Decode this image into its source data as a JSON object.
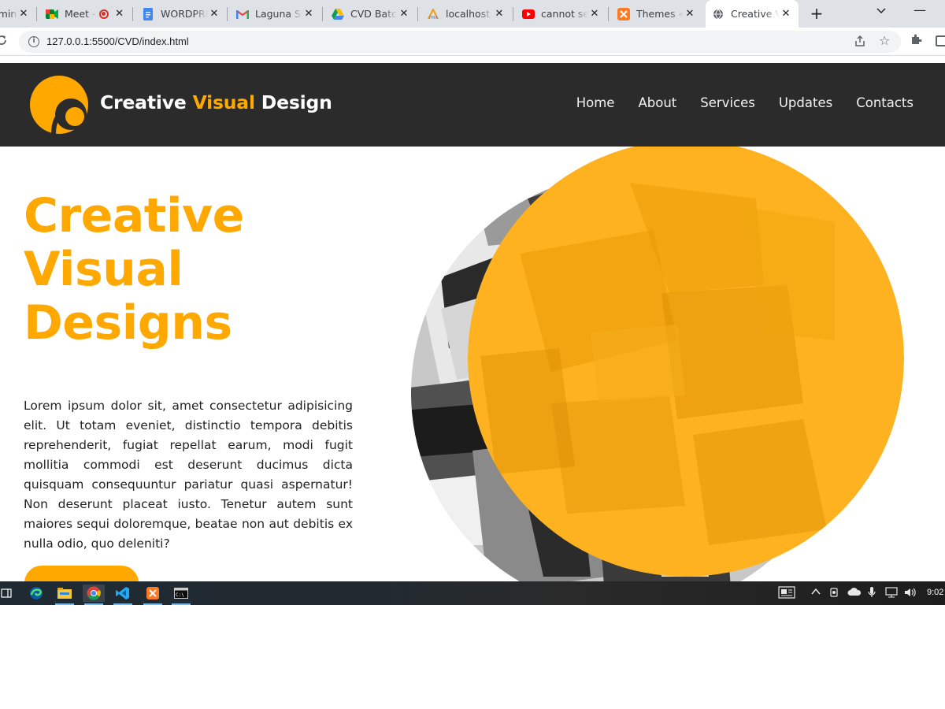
{
  "browser": {
    "tabs": [
      {
        "title": "amin",
        "icon": "yellow-square-icon",
        "active": false
      },
      {
        "title": "Meet - ",
        "icon": "google-meet-icon",
        "active": false,
        "recording": true
      },
      {
        "title": "WORDPRE",
        "icon": "google-docs-icon",
        "active": false
      },
      {
        "title": "Laguna Sta",
        "icon": "gmail-icon",
        "active": false
      },
      {
        "title": "CVD Batch",
        "icon": "google-drive-icon",
        "active": false
      },
      {
        "title": "localhost /",
        "icon": "phpmyadmin-icon",
        "active": false
      },
      {
        "title": "cannot sele",
        "icon": "youtube-icon",
        "active": false
      },
      {
        "title": "Themes « (",
        "icon": "xampp-icon",
        "active": false
      },
      {
        "title": "Creative V",
        "icon": "globe-icon",
        "active": true
      }
    ],
    "new_tab": "+",
    "url": "127.0.0.1:5500/CVD/index.html"
  },
  "site": {
    "brand": {
      "part1": "Creative ",
      "part2": "Visual",
      "part3": " Design"
    },
    "nav": [
      "Home",
      "About",
      "Services",
      "Updates",
      "Contacts"
    ],
    "hero": {
      "title_lines": [
        "Creative",
        "Visual",
        "Designs"
      ],
      "paragraph": "Lorem ipsum dolor sit, amet consectetur adipisicing elit. Ut totam eveniet, distinctio tempora debitis reprehenderit, fugiat repellat earum, modi fugit mollitia commodi est deserunt ducimus dicta quisquam consequuntur pariatur quasi aspernatur! Non deserunt placeat iusto. Tenetur autem sunt maiores sequi doloremque, beatae non aut debitis ex nulla odio, quo deleniti?"
    },
    "colors": {
      "accent": "#ffa800",
      "header_bg": "#2b2b2b"
    }
  },
  "taskbar": {
    "apps": [
      "task-view-icon",
      "edge-icon",
      "file-explorer-icon",
      "chrome-icon",
      "vscode-icon",
      "xampp-icon",
      "terminal-icon"
    ],
    "clock": "9:02"
  }
}
